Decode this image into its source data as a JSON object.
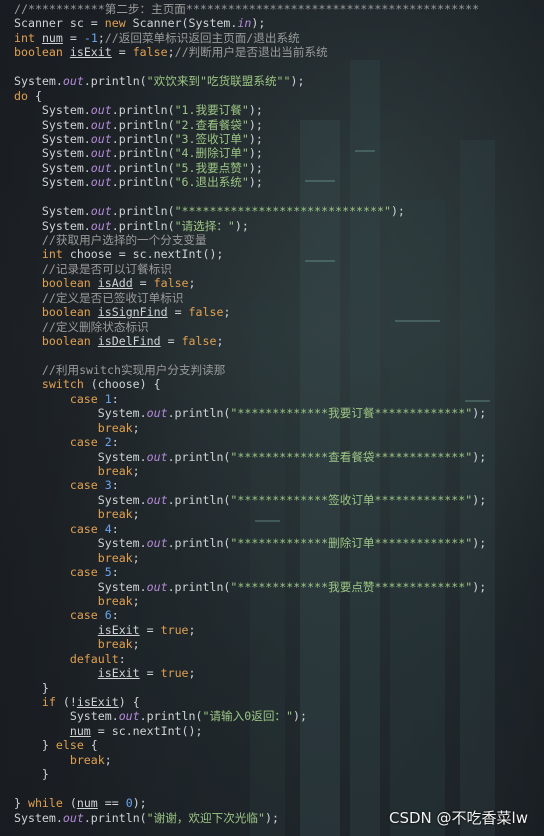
{
  "watermark": "CSDN @不吃香菜lw",
  "code_lines": [
    [
      {
        "t": "//***********第二步：主页面******************************************",
        "c": "cmt"
      }
    ],
    [
      {
        "t": "Scanner sc = "
      },
      {
        "t": "new",
        "c": "kw"
      },
      {
        "t": " Scanner(System."
      },
      {
        "t": "in",
        "c": "fld"
      },
      {
        "t": ");"
      }
    ],
    [
      {
        "t": "int",
        "c": "kw"
      },
      {
        "t": " "
      },
      {
        "t": "num",
        "c": "var"
      },
      {
        "t": " = "
      },
      {
        "t": "-1",
        "c": "num"
      },
      {
        "t": ";"
      },
      {
        "t": "//返回菜单标识返回主页面/退出系统",
        "c": "cmt"
      }
    ],
    [
      {
        "t": "boolean",
        "c": "kw"
      },
      {
        "t": " "
      },
      {
        "t": "isExit",
        "c": "var"
      },
      {
        "t": " = "
      },
      {
        "t": "false",
        "c": "kw"
      },
      {
        "t": ";"
      },
      {
        "t": "//判断用户是否退出当前系统",
        "c": "cmt"
      }
    ],
    [
      {
        "t": ""
      }
    ],
    [
      {
        "t": "System."
      },
      {
        "t": "out",
        "c": "fld"
      },
      {
        "t": ".println("
      },
      {
        "t": "\"欢饮来到\"吃货联盟系统\"\"",
        "c": "str"
      },
      {
        "t": ");"
      }
    ],
    [
      {
        "t": "do",
        "c": "kw"
      },
      {
        "t": " {"
      }
    ],
    [
      {
        "t": "    System."
      },
      {
        "t": "out",
        "c": "fld"
      },
      {
        "t": ".println("
      },
      {
        "t": "\"1.我要订餐\"",
        "c": "str"
      },
      {
        "t": ");"
      }
    ],
    [
      {
        "t": "    System."
      },
      {
        "t": "out",
        "c": "fld"
      },
      {
        "t": ".println("
      },
      {
        "t": "\"2.查看餐袋\"",
        "c": "str"
      },
      {
        "t": ");"
      }
    ],
    [
      {
        "t": "    System."
      },
      {
        "t": "out",
        "c": "fld"
      },
      {
        "t": ".println("
      },
      {
        "t": "\"3.签收订单\"",
        "c": "str"
      },
      {
        "t": ");"
      }
    ],
    [
      {
        "t": "    System."
      },
      {
        "t": "out",
        "c": "fld"
      },
      {
        "t": ".println("
      },
      {
        "t": "\"4.删除订单\"",
        "c": "str"
      },
      {
        "t": ");"
      }
    ],
    [
      {
        "t": "    System."
      },
      {
        "t": "out",
        "c": "fld"
      },
      {
        "t": ".println("
      },
      {
        "t": "\"5.我要点赞\"",
        "c": "str"
      },
      {
        "t": ");"
      }
    ],
    [
      {
        "t": "    System."
      },
      {
        "t": "out",
        "c": "fld"
      },
      {
        "t": ".println("
      },
      {
        "t": "\"6.退出系统\"",
        "c": "str"
      },
      {
        "t": ");"
      }
    ],
    [
      {
        "t": ""
      }
    ],
    [
      {
        "t": "    System."
      },
      {
        "t": "out",
        "c": "fld"
      },
      {
        "t": ".println("
      },
      {
        "t": "\"*****************************\"",
        "c": "str"
      },
      {
        "t": ");"
      }
    ],
    [
      {
        "t": "    System."
      },
      {
        "t": "out",
        "c": "fld"
      },
      {
        "t": ".println("
      },
      {
        "t": "\"请选择：\"",
        "c": "str"
      },
      {
        "t": ");"
      }
    ],
    [
      {
        "t": "    //获取用户选择的一个分支变量",
        "c": "cmt"
      }
    ],
    [
      {
        "t": "    "
      },
      {
        "t": "int",
        "c": "kw"
      },
      {
        "t": " choose = sc.nextInt();"
      }
    ],
    [
      {
        "t": "    //记录是否可以订餐标识",
        "c": "cmt"
      }
    ],
    [
      {
        "t": "    "
      },
      {
        "t": "boolean",
        "c": "kw"
      },
      {
        "t": " "
      },
      {
        "t": "isAdd",
        "c": "var"
      },
      {
        "t": " = "
      },
      {
        "t": "false",
        "c": "kw"
      },
      {
        "t": ";"
      }
    ],
    [
      {
        "t": "    //定义是否已签收订单标识",
        "c": "cmt"
      }
    ],
    [
      {
        "t": "    "
      },
      {
        "t": "boolean",
        "c": "kw"
      },
      {
        "t": " "
      },
      {
        "t": "isSignFind",
        "c": "var"
      },
      {
        "t": " = "
      },
      {
        "t": "false",
        "c": "kw"
      },
      {
        "t": ";"
      }
    ],
    [
      {
        "t": "    //定义删除状态标识",
        "c": "cmt"
      }
    ],
    [
      {
        "t": "    "
      },
      {
        "t": "boolean",
        "c": "kw"
      },
      {
        "t": " "
      },
      {
        "t": "isDelFind",
        "c": "var"
      },
      {
        "t": " = "
      },
      {
        "t": "false",
        "c": "kw"
      },
      {
        "t": ";"
      }
    ],
    [
      {
        "t": ""
      }
    ],
    [
      {
        "t": "    //利用switch实现用户分支判读那",
        "c": "cmt"
      }
    ],
    [
      {
        "t": "    "
      },
      {
        "t": "switch",
        "c": "kw"
      },
      {
        "t": " (choose) {"
      }
    ],
    [
      {
        "t": "        "
      },
      {
        "t": "case",
        "c": "kw"
      },
      {
        "t": " "
      },
      {
        "t": "1",
        "c": "num"
      },
      {
        "t": ":"
      }
    ],
    [
      {
        "t": "            System."
      },
      {
        "t": "out",
        "c": "fld"
      },
      {
        "t": ".println("
      },
      {
        "t": "\"*************我要订餐*************\"",
        "c": "str"
      },
      {
        "t": ");"
      }
    ],
    [
      {
        "t": "            "
      },
      {
        "t": "break",
        "c": "kw"
      },
      {
        "t": ";"
      }
    ],
    [
      {
        "t": "        "
      },
      {
        "t": "case",
        "c": "kw"
      },
      {
        "t": " "
      },
      {
        "t": "2",
        "c": "num"
      },
      {
        "t": ":"
      }
    ],
    [
      {
        "t": "            System."
      },
      {
        "t": "out",
        "c": "fld"
      },
      {
        "t": ".println("
      },
      {
        "t": "\"*************查看餐袋*************\"",
        "c": "str"
      },
      {
        "t": ");"
      }
    ],
    [
      {
        "t": "            "
      },
      {
        "t": "break",
        "c": "kw"
      },
      {
        "t": ";"
      }
    ],
    [
      {
        "t": "        "
      },
      {
        "t": "case",
        "c": "kw"
      },
      {
        "t": " "
      },
      {
        "t": "3",
        "c": "num"
      },
      {
        "t": ":"
      }
    ],
    [
      {
        "t": "            System."
      },
      {
        "t": "out",
        "c": "fld"
      },
      {
        "t": ".println("
      },
      {
        "t": "\"*************签收订单*************\"",
        "c": "str"
      },
      {
        "t": ");"
      }
    ],
    [
      {
        "t": "            "
      },
      {
        "t": "break",
        "c": "kw"
      },
      {
        "t": ";"
      }
    ],
    [
      {
        "t": "        "
      },
      {
        "t": "case",
        "c": "kw"
      },
      {
        "t": " "
      },
      {
        "t": "4",
        "c": "num"
      },
      {
        "t": ":"
      }
    ],
    [
      {
        "t": "            System."
      },
      {
        "t": "out",
        "c": "fld"
      },
      {
        "t": ".println("
      },
      {
        "t": "\"*************删除订单*************\"",
        "c": "str"
      },
      {
        "t": ");"
      }
    ],
    [
      {
        "t": "            "
      },
      {
        "t": "break",
        "c": "kw"
      },
      {
        "t": ";"
      }
    ],
    [
      {
        "t": "        "
      },
      {
        "t": "case",
        "c": "kw"
      },
      {
        "t": " "
      },
      {
        "t": "5",
        "c": "num"
      },
      {
        "t": ":"
      }
    ],
    [
      {
        "t": "            System."
      },
      {
        "t": "out",
        "c": "fld"
      },
      {
        "t": ".println("
      },
      {
        "t": "\"*************我要点赞*************\"",
        "c": "str"
      },
      {
        "t": ");"
      }
    ],
    [
      {
        "t": "            "
      },
      {
        "t": "break",
        "c": "kw"
      },
      {
        "t": ";"
      }
    ],
    [
      {
        "t": "        "
      },
      {
        "t": "case",
        "c": "kw"
      },
      {
        "t": " "
      },
      {
        "t": "6",
        "c": "num"
      },
      {
        "t": ":"
      }
    ],
    [
      {
        "t": "            "
      },
      {
        "t": "isExit",
        "c": "var"
      },
      {
        "t": " = "
      },
      {
        "t": "true",
        "c": "kw"
      },
      {
        "t": ";"
      }
    ],
    [
      {
        "t": "            "
      },
      {
        "t": "break",
        "c": "kw"
      },
      {
        "t": ";"
      }
    ],
    [
      {
        "t": "        "
      },
      {
        "t": "default",
        "c": "kw"
      },
      {
        "t": ":"
      }
    ],
    [
      {
        "t": "            "
      },
      {
        "t": "isExit",
        "c": "var"
      },
      {
        "t": " = "
      },
      {
        "t": "true",
        "c": "kw"
      },
      {
        "t": ";"
      }
    ],
    [
      {
        "t": "    }"
      }
    ],
    [
      {
        "t": "    "
      },
      {
        "t": "if",
        "c": "kw"
      },
      {
        "t": " (!"
      },
      {
        "t": "isExit",
        "c": "var"
      },
      {
        "t": ") {"
      }
    ],
    [
      {
        "t": "        System."
      },
      {
        "t": "out",
        "c": "fld"
      },
      {
        "t": ".println("
      },
      {
        "t": "\"请输入0返回：\"",
        "c": "str"
      },
      {
        "t": ");"
      }
    ],
    [
      {
        "t": "        "
      },
      {
        "t": "num",
        "c": "var"
      },
      {
        "t": " = sc.nextInt();"
      }
    ],
    [
      {
        "t": "    } "
      },
      {
        "t": "else",
        "c": "kw"
      },
      {
        "t": " {"
      }
    ],
    [
      {
        "t": "        "
      },
      {
        "t": "break",
        "c": "kw"
      },
      {
        "t": ";"
      }
    ],
    [
      {
        "t": "    }"
      }
    ],
    [
      {
        "t": ""
      }
    ],
    [
      {
        "t": "} "
      },
      {
        "t": "while",
        "c": "kw"
      },
      {
        "t": " ("
      },
      {
        "t": "num",
        "c": "var"
      },
      {
        "t": " == "
      },
      {
        "t": "0",
        "c": "num"
      },
      {
        "t": ");"
      }
    ],
    [
      {
        "t": "System."
      },
      {
        "t": "out",
        "c": "fld"
      },
      {
        "t": ".println("
      },
      {
        "t": "\"谢谢，欢迎下次光临\"",
        "c": "str"
      },
      {
        "t": ");"
      }
    ]
  ]
}
